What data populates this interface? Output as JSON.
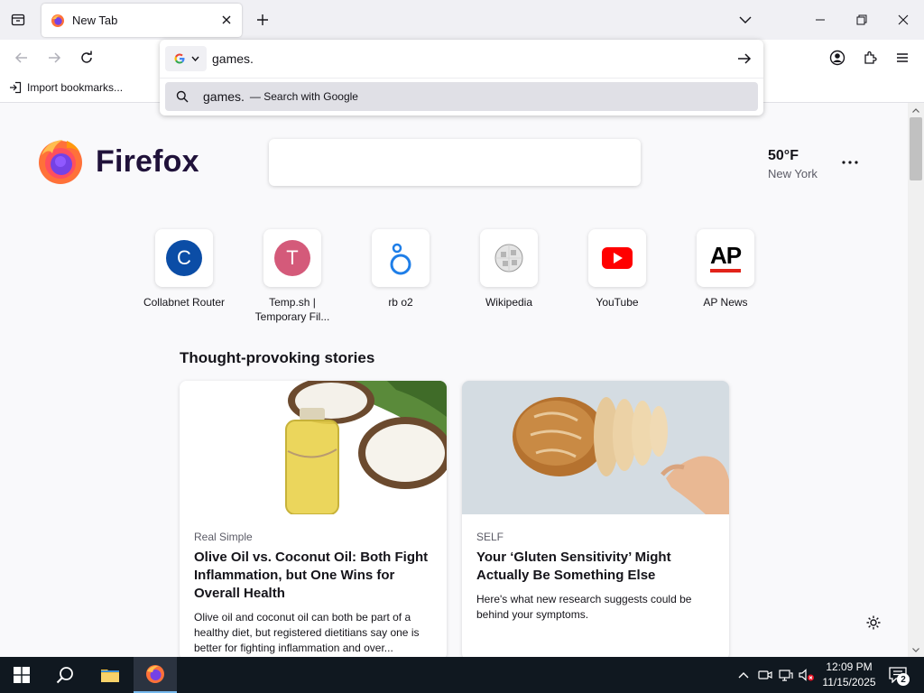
{
  "tabs": [
    {
      "title": "New Tab",
      "icon": "firefox-icon"
    }
  ],
  "toolbar": {
    "icons": [
      "back-icon",
      "forward-icon",
      "reload-icon",
      "account-icon",
      "extensions-icon",
      "menu-icon"
    ]
  },
  "urlbar": {
    "value": "games.",
    "engine_icon": "google-icon",
    "suggestion": {
      "text": "games.",
      "action": "— Search with Google"
    }
  },
  "bookmarks": {
    "import_label": "Import bookmarks..."
  },
  "newtab": {
    "brand": "Firefox",
    "weather": {
      "temp": "50°F",
      "city": "New York"
    },
    "shortcuts": [
      {
        "label_lines": [
          "Collabnet Router"
        ],
        "letter": "C",
        "color": "#0b4da6"
      },
      {
        "label_lines": [
          "Temp.sh |",
          "Temporary Fil..."
        ],
        "letter": "T",
        "color": "#d45a7a"
      },
      {
        "label_lines": [
          "rb o2"
        ],
        "letter": "",
        "color": "#1e7ee8"
      },
      {
        "label_lines": [
          "Wikipedia"
        ],
        "letter": "",
        "color": "#8a8a8a"
      },
      {
        "label_lines": [
          "YouTube"
        ],
        "letter": "",
        "color": "#ff0000"
      },
      {
        "label_lines": [
          "AP News"
        ],
        "letter": "AP",
        "color": "#000000"
      }
    ],
    "section_title": "Thought-provoking stories",
    "stories": [
      {
        "source": "Real Simple",
        "title": "Olive Oil vs. Coconut Oil: Both Fight Inflammation, but One Wins for Overall Health",
        "excerpt": "Olive oil and coconut oil can both be part of a healthy diet, but registered dietitians say one is better for fighting inflammation and over..."
      },
      {
        "source": "SELF",
        "title": "Your ‘Gluten Sensitivity’ Might Actually Be Something Else",
        "excerpt": "Here's what new research suggests could be behind your symptoms."
      }
    ]
  },
  "taskbar": {
    "time": "12:09 PM",
    "date": "11/15/2025",
    "notification_count": "2"
  }
}
